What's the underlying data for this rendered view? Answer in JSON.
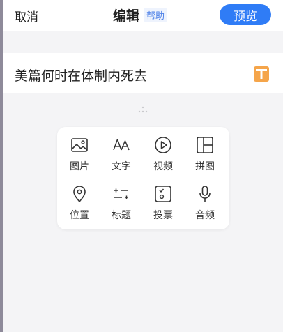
{
  "header": {
    "cancel_label": "取消",
    "title": "编辑",
    "help_label": "帮助",
    "preview_label": "预览"
  },
  "article": {
    "title": "美篇何时在体制内死去"
  },
  "insert_menu": {
    "items": [
      {
        "label": "图片",
        "icon": "image-icon"
      },
      {
        "label": "文字",
        "icon": "text-icon"
      },
      {
        "label": "视频",
        "icon": "video-icon"
      },
      {
        "label": "拼图",
        "icon": "collage-icon"
      },
      {
        "label": "位置",
        "icon": "location-icon"
      },
      {
        "label": "标题",
        "icon": "heading-icon"
      },
      {
        "label": "投票",
        "icon": "vote-icon"
      },
      {
        "label": "音频",
        "icon": "audio-icon"
      }
    ]
  },
  "colors": {
    "accent": "#2f7cf6",
    "text_tool": "#f5a54a",
    "background": "#f4f4f6"
  }
}
